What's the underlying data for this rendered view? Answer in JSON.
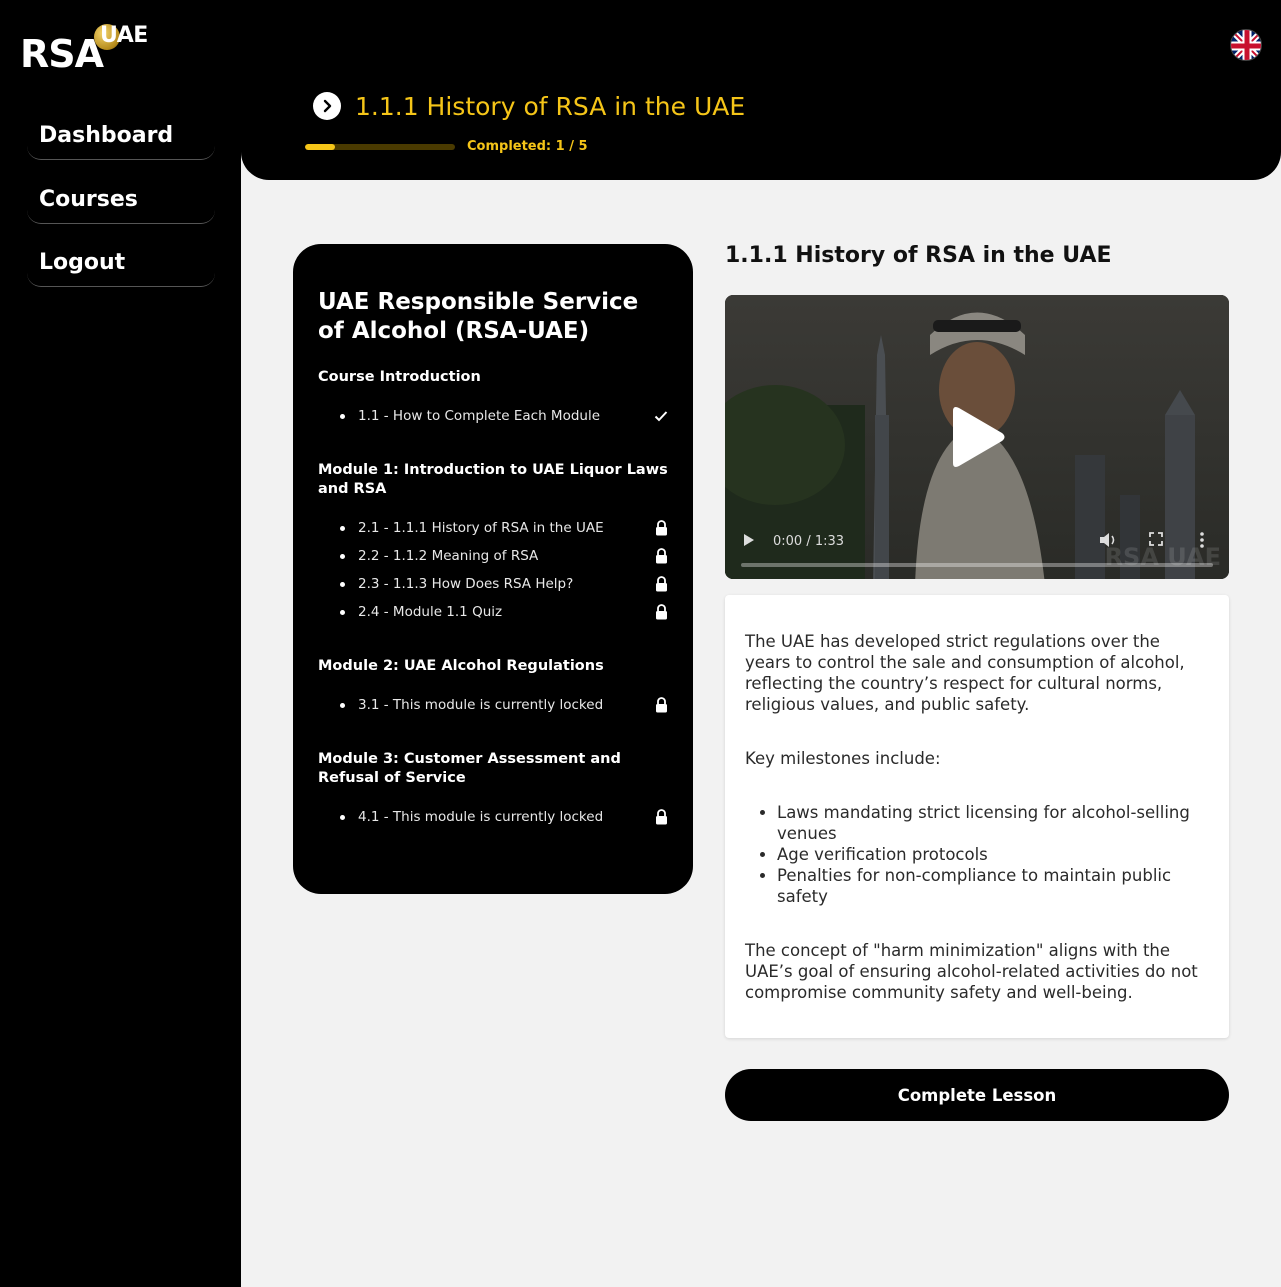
{
  "brand": {
    "logo_main": "RSA",
    "logo_sub": "UAE"
  },
  "sidebar": {
    "items": [
      {
        "label": "Dashboard"
      },
      {
        "label": "Courses"
      },
      {
        "label": "Logout"
      }
    ]
  },
  "header": {
    "lesson_title": "1.1.1 History of RSA in the UAE",
    "progress_label": "Completed: 1 / 5",
    "progress_fraction": 0.2,
    "language_icon": "uk-flag-icon"
  },
  "course": {
    "title": "UAE Responsible Service of Alcohol (RSA-UAE)",
    "modules": [
      {
        "title": "Course Introduction",
        "lessons": [
          {
            "label": "1.1 - How to Complete Each Module",
            "state": "completed"
          }
        ]
      },
      {
        "title": "Module 1: Introduction to UAE Liquor Laws and RSA",
        "lessons": [
          {
            "label": "2.1 - 1.1.1 History of RSA in the UAE",
            "state": "locked"
          },
          {
            "label": "2.2 - 1.1.2 Meaning of RSA",
            "state": "locked"
          },
          {
            "label": "2.3 - 1.1.3 How Does RSA Help?",
            "state": "locked"
          },
          {
            "label": "2.4 - Module 1.1 Quiz",
            "state": "locked"
          }
        ]
      },
      {
        "title": "Module 2: UAE Alcohol Regulations",
        "lessons": [
          {
            "label": "3.1 - This module is currently locked",
            "state": "locked"
          }
        ]
      },
      {
        "title": "Module 3: Customer Assessment and Refusal of Service",
        "lessons": [
          {
            "label": "4.1 - This module is currently locked",
            "state": "locked"
          }
        ]
      }
    ]
  },
  "content": {
    "title": "1.1.1 History of RSA in the UAE",
    "video": {
      "time": "0:00 / 1:33",
      "watermark": "RSA UAE"
    },
    "paragraph1": "The UAE has developed strict regulations over the years to control the sale and consumption of alcohol, reflecting the country’s respect for cultural norms, religious values, and public safety.",
    "paragraph2": "Key milestones include:",
    "bullets": [
      "Laws mandating strict licensing for alcohol-selling venues",
      "Age verification protocols",
      "Penalties for non-compliance to maintain public safety"
    ],
    "paragraph3": "The concept of \"harm minimization\" aligns with the UAE’s goal of ensuring alcohol-related activities do not compromise community safety and well-being.",
    "complete_button": "Complete Lesson"
  },
  "colors": {
    "accent": "#f5c518",
    "background": "#f2f2f2",
    "dark": "#000000"
  }
}
